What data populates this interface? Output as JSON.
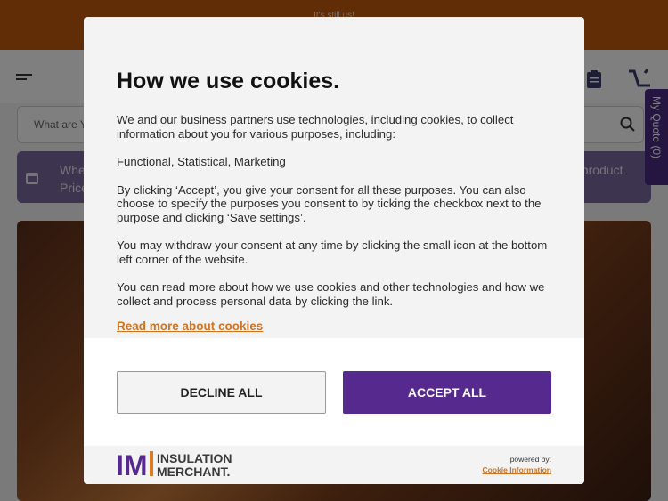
{
  "topbar": {
    "text": "It's still us!"
  },
  "search": {
    "placeholder": "What are You looking for?"
  },
  "promo": {
    "left_text": "When Price",
    "right_text": "t product"
  },
  "side_tab": {
    "label": "My Quote (0)"
  },
  "modal": {
    "title": "How we use cookies.",
    "paragraphs": [
      "We and our business partners use technologies, including cookies, to collect information about you for various purposes, including:",
      "Functional, Statistical, Marketing",
      "By clicking ‘Accept’, you give your consent for all these purposes. You can also choose to specify the purposes you consent to by ticking the checkbox next to the purpose and clicking ‘Save settings’.",
      "You may withdraw your consent at any time by clicking the small icon at the bottom left corner of the website.",
      "You can read more about how we use cookies and other technologies and how we collect and process personal data by clicking the link."
    ],
    "read_more": "Read more about cookies",
    "decline_label": "DECLINE ALL",
    "accept_label": "ACCEPT ALL",
    "logo": {
      "mark": "IM",
      "line1": "INSULATION",
      "line2": "MERCHANT."
    },
    "powered_by": "powered by:",
    "powered_link": "Cookie Information"
  },
  "colors": {
    "accent_purple": "#55298e",
    "link_orange": "#d4721f",
    "topbar_orange": "#c25a0f"
  }
}
